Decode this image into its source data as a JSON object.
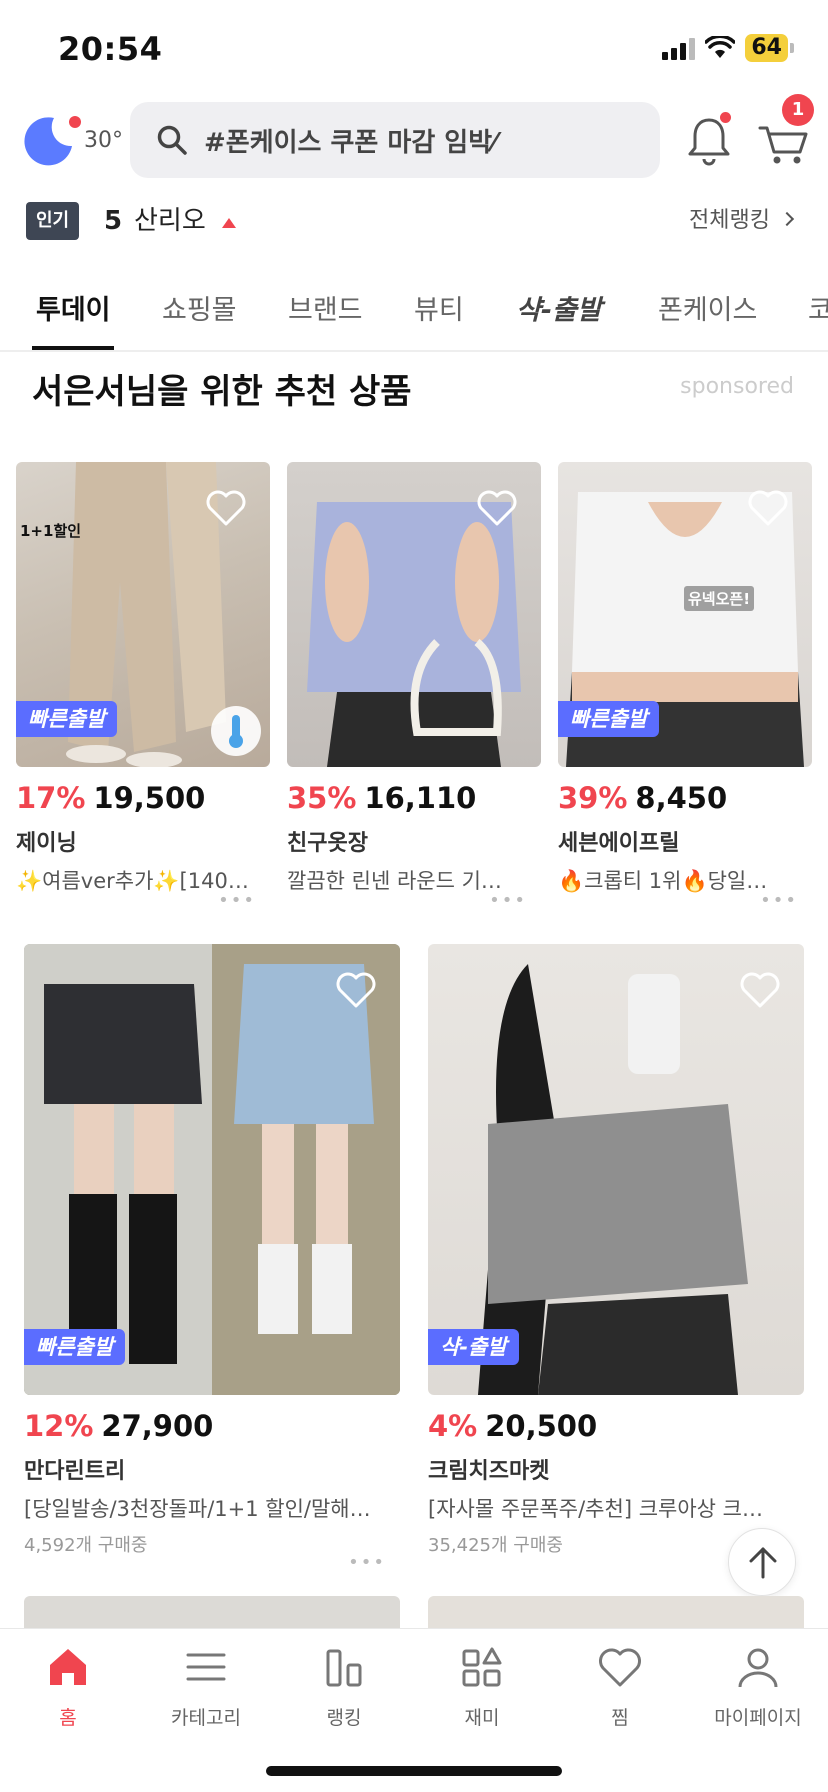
{
  "status_bar": {
    "time": "20:54",
    "battery": "64"
  },
  "header": {
    "temperature": "30°",
    "search_placeholder": "#폰케이스 쿠폰 마감 임박⁄",
    "cart_count": "1"
  },
  "ranking": {
    "badge": "인기",
    "rank": "5",
    "name": "산리오",
    "all_label": "전체랭킹"
  },
  "tabs": [
    {
      "label": "투데이"
    },
    {
      "label": "쇼핑몰"
    },
    {
      "label": "브랜드"
    },
    {
      "label": "뷰티"
    },
    {
      "label": "샥-출발"
    },
    {
      "label": "폰케이스"
    },
    {
      "label": "코"
    }
  ],
  "section": {
    "title": "서은서님을 위한 추천 상품",
    "sponsored": "sponsored"
  },
  "products_small": [
    {
      "discount": "17%",
      "price": "19,500",
      "shop": "제이닝",
      "desc": "✨여름ver추가✨[140…",
      "badge": "빠른출발",
      "note": "1+1할인"
    },
    {
      "discount": "35%",
      "price": "16,110",
      "shop": "친구옷장",
      "desc": "깔끔한 린넨 라운드 기…"
    },
    {
      "discount": "39%",
      "price": "8,450",
      "shop": "세븐에이프릴",
      "desc": "🔥크롭티 1위🔥당일…",
      "badge": "빠른출발",
      "note": "유넥오픈!"
    }
  ],
  "products_large": [
    {
      "discount": "12%",
      "price": "27,900",
      "shop": "만다린트리",
      "desc": "[당일발송/3천장돌파/1+1 할인/말해…",
      "buying": "4,592개 구매중",
      "badge": "빠른출발"
    },
    {
      "discount": "4%",
      "price": "20,500",
      "shop": "크림치즈마켓",
      "desc": "[자사몰 주문폭주/추천] 크루아상 크…",
      "buying": "35,425개 구매중",
      "badge": "샥-출발"
    }
  ],
  "more_dots": "•••",
  "bottom_nav": [
    {
      "label": "홈"
    },
    {
      "label": "카테고리"
    },
    {
      "label": "랭킹"
    },
    {
      "label": "재미"
    },
    {
      "label": "찜"
    },
    {
      "label": "마이페이지"
    }
  ],
  "colors": {
    "accent": "#f0454f",
    "fast_badge": "#5b6dff",
    "moon": "#5b7bff"
  }
}
